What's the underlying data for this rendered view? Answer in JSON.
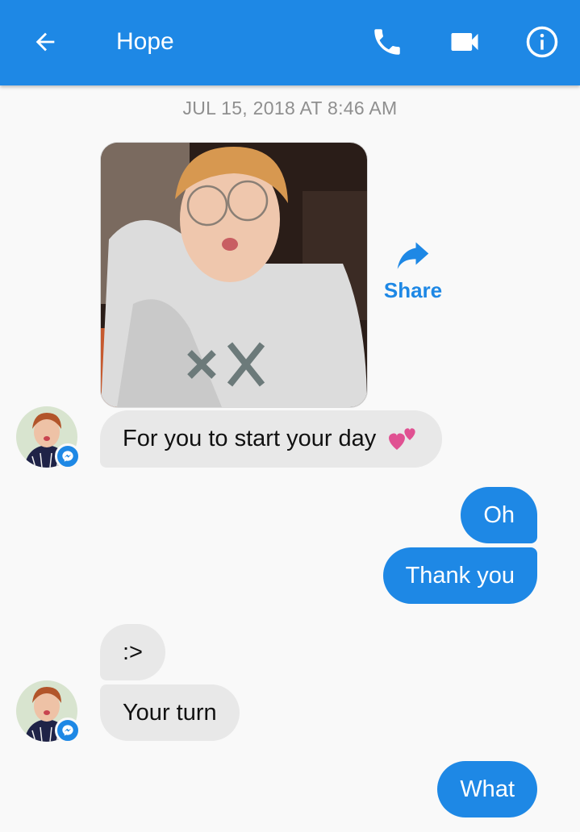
{
  "header": {
    "contact_name": "Hope",
    "icons": [
      "back-arrow-icon",
      "phone-icon",
      "video-camera-icon",
      "info-icon"
    ],
    "bar_color": "#1e88e5"
  },
  "conversation": {
    "timestamp": "JUL 15, 2018 AT 8:46 AM",
    "share_label": "Share",
    "messages": [
      {
        "from": "contact",
        "type": "image"
      },
      {
        "from": "contact",
        "text": "For you to start your day",
        "emoji": "two-hearts"
      },
      {
        "from": "me",
        "text": "Oh"
      },
      {
        "from": "me",
        "text": "Thank you"
      },
      {
        "from": "contact",
        "text": ":>"
      },
      {
        "from": "contact",
        "text": "Your turn"
      },
      {
        "from": "me",
        "text": "What"
      }
    ]
  },
  "colors": {
    "outgoing_bubble": "#1e88e5",
    "incoming_bubble": "#e8e8e8",
    "background": "#f9f9f9",
    "timestamp_text": "#8f8f8f"
  }
}
